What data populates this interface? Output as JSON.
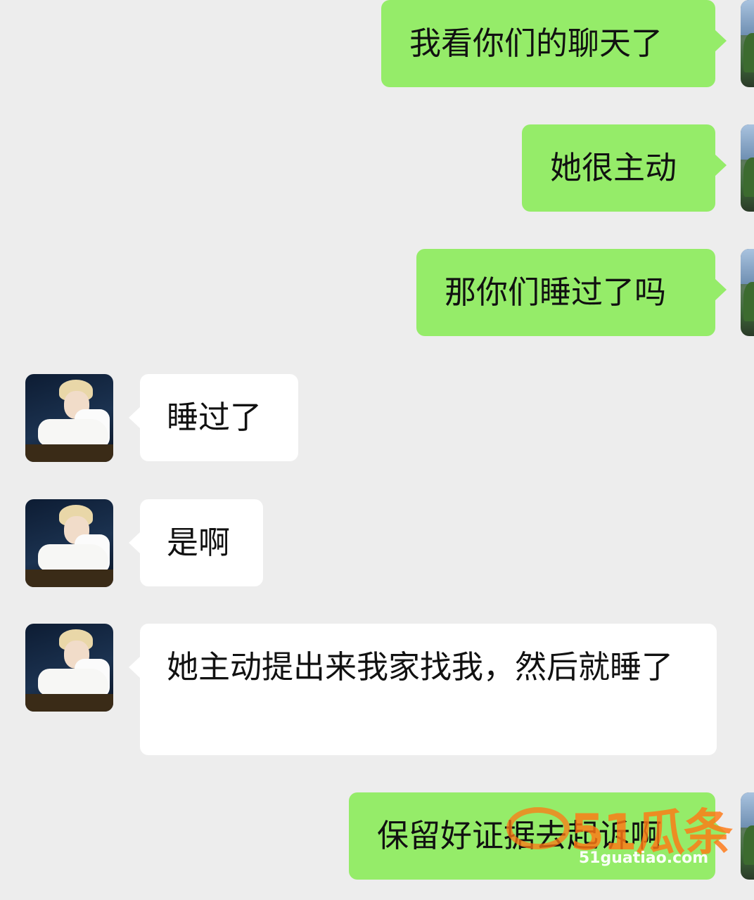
{
  "messages": [
    {
      "side": "right",
      "text": "我看你们的聊天了"
    },
    {
      "side": "right",
      "text": "她很主动"
    },
    {
      "side": "right",
      "text": "那你们睡过了吗"
    },
    {
      "side": "left",
      "text": "睡过了"
    },
    {
      "side": "left",
      "text": "是啊"
    },
    {
      "side": "left",
      "text": "她主动提出来我家找我，然后就睡了"
    },
    {
      "side": "right",
      "text": "保留好证据去起诉啊"
    }
  ],
  "watermark": {
    "logo": "51瓜条",
    "url": "51guatiao.com"
  },
  "colors": {
    "background": "#ededed",
    "outgoing_bubble": "#95ec69",
    "incoming_bubble": "#ffffff",
    "watermark": "#ff7814"
  }
}
